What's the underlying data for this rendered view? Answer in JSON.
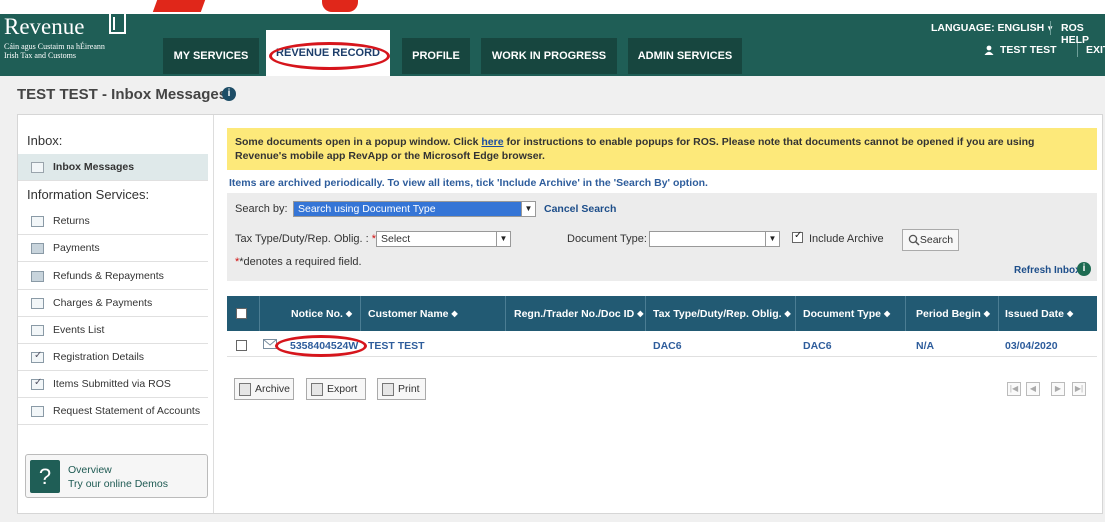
{
  "header": {
    "logo_word": "Revenue",
    "logo_sub1": "Cáin agus Custaim na hÉireann",
    "logo_sub2": "Irish Tax and Customs",
    "tabs": [
      {
        "label": "MY SERVICES"
      },
      {
        "label": "REVENUE RECORD"
      },
      {
        "label": "PROFILE"
      },
      {
        "label": "WORK IN PROGRESS"
      },
      {
        "label": "ADMIN SERVICES"
      }
    ],
    "language_label": "LANGUAGE: ENGLISH",
    "ros_help": "ROS HELP",
    "user_name": "TEST TEST",
    "exit_label": "EXIT"
  },
  "page": {
    "title": "TEST TEST - Inbox Messages"
  },
  "sidebar": {
    "inbox_heading": "Inbox:",
    "inbox_item": "Inbox Messages",
    "info_heading": "Information Services:",
    "items": [
      {
        "label": "Returns"
      },
      {
        "label": "Payments"
      },
      {
        "label": "Refunds & Repayments"
      },
      {
        "label": "Charges & Payments"
      },
      {
        "label": "Events List"
      },
      {
        "label": "Registration Details"
      },
      {
        "label": "Items Submitted via ROS"
      },
      {
        "label": "Request Statement of Accounts"
      }
    ],
    "demo_line1": "Overview",
    "demo_line2": "Try our online Demos"
  },
  "notice": {
    "before_link": "Some documents open in a popup window. Click ",
    "link": "here",
    "after_link": " for instructions to enable popups for ROS. Please note that documents cannot be opened if you are using Revenue's mobile app RevApp or the Microsoft Edge browser.",
    "archive_note": "Items are archived periodically. To view all items, tick 'Include Archive' in the 'Search By' option."
  },
  "search": {
    "search_by_label": "Search by:",
    "search_by_value": "Search using Document Type",
    "cancel_search": "Cancel Search",
    "tax_type_label": "Tax Type/Duty/Rep. Oblig. :",
    "tax_type_value": "Select",
    "doc_type_label": "Document Type:",
    "doc_type_value": "",
    "include_archive_label": "Include Archive",
    "include_archive_checked": true,
    "search_button": "Search",
    "required_note": "*denotes a required field.",
    "refresh_label": "Refresh Inbox"
  },
  "table": {
    "columns": [
      "Notice No.",
      "Customer Name",
      "Regn./Trader No./Doc ID",
      "Tax Type/Duty/Rep. Oblig.",
      "Document Type",
      "Period Begin",
      "Issued Date"
    ],
    "rows": [
      {
        "notice_no": "5358404524W",
        "customer": "TEST TEST",
        "regn": "",
        "tax_type": "DAC6",
        "doc_type": "DAC6",
        "period_begin": "N/A",
        "issued": "03/04/2020"
      }
    ]
  },
  "actions": {
    "archive": "Archive",
    "export": "Export",
    "print": "Print"
  }
}
